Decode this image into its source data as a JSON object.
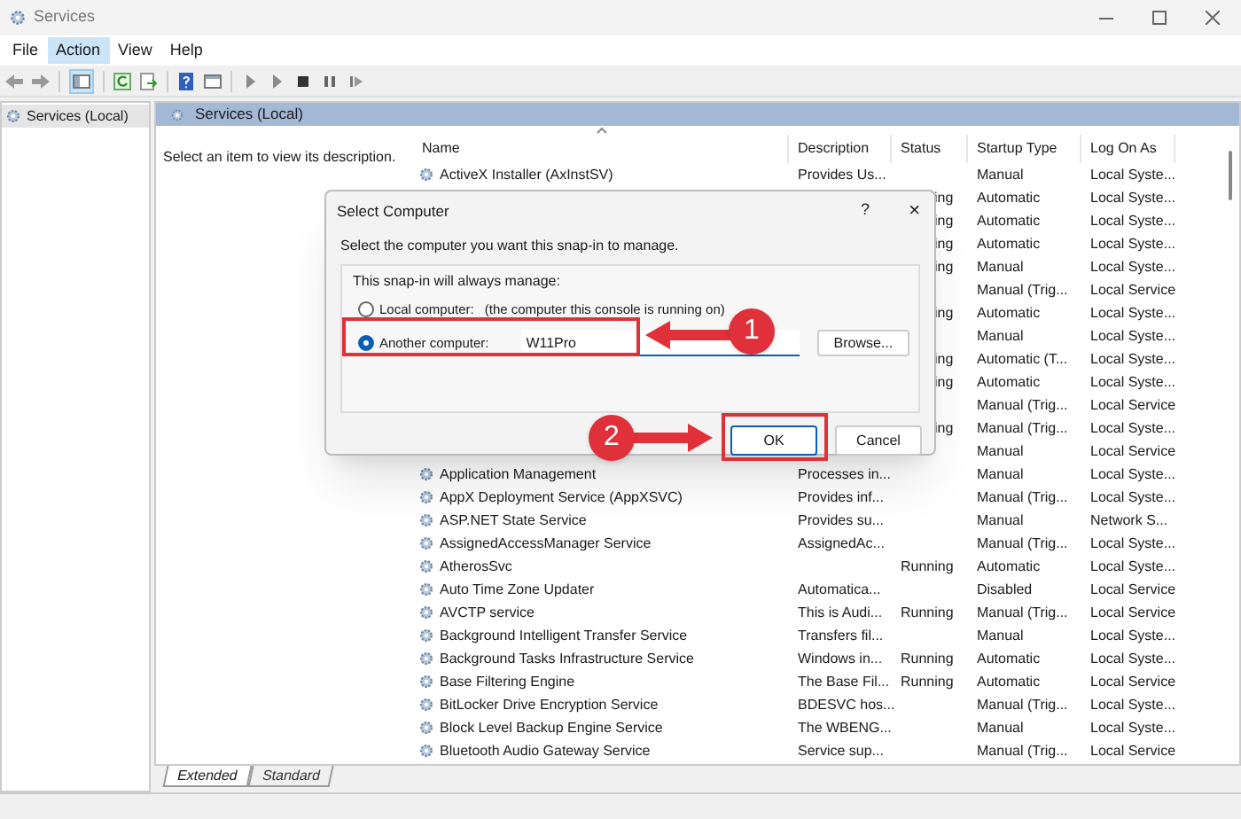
{
  "window": {
    "title": "Services"
  },
  "menu": [
    {
      "label": "File",
      "selected": false
    },
    {
      "label": "Action",
      "selected": true
    },
    {
      "label": "View",
      "selected": false
    },
    {
      "label": "Help",
      "selected": false
    }
  ],
  "toolbar": {
    "console_tree_pressed": true
  },
  "tree": {
    "items": [
      {
        "label": "Services (Local)",
        "selected": true
      }
    ]
  },
  "pane": {
    "title": "Services (Local)",
    "description_hint": "Select an item to view its description."
  },
  "table": {
    "columns": [
      "Name",
      "Description",
      "Status",
      "Startup Type",
      "Log On As"
    ],
    "rows": [
      {
        "kind": "full",
        "name": "ActiveX Installer (AxInstSV)",
        "description": "Provides Us...",
        "status": "",
        "startup": "Manual",
        "logon": "Local Syste..."
      },
      {
        "kind": "covered",
        "status": "ing",
        "startup": "Automatic",
        "logon": "Local Syste..."
      },
      {
        "kind": "covered",
        "status": "ing",
        "startup": "Automatic",
        "logon": "Local Syste..."
      },
      {
        "kind": "covered",
        "status": "ing",
        "startup": "Automatic",
        "logon": "Local Syste..."
      },
      {
        "kind": "covered",
        "status": "ing",
        "startup": "Manual",
        "logon": "Local Syste..."
      },
      {
        "kind": "covered",
        "status": "",
        "startup": "Manual (Trig...",
        "logon": "Local Service"
      },
      {
        "kind": "covered",
        "status": "ing",
        "startup": "Automatic",
        "logon": "Local Syste..."
      },
      {
        "kind": "covered",
        "status": "",
        "startup": "Manual",
        "logon": "Local Syste..."
      },
      {
        "kind": "covered",
        "status": "ing",
        "startup": "Automatic (T...",
        "logon": "Local Syste..."
      },
      {
        "kind": "covered",
        "status": "ing",
        "startup": "Automatic",
        "logon": "Local Syste..."
      },
      {
        "kind": "covered",
        "status": "",
        "startup": "Manual (Trig...",
        "logon": "Local Service"
      },
      {
        "kind": "covered",
        "status": "ing",
        "startup": "Manual (Trig...",
        "logon": "Local Syste..."
      },
      {
        "kind": "covered",
        "status": "",
        "startup": "Manual",
        "logon": "Local Service"
      },
      {
        "kind": "full",
        "name": "Application Management",
        "description": "Processes in...",
        "status": "",
        "startup": "Manual",
        "logon": "Local Syste..."
      },
      {
        "kind": "full",
        "name": "AppX Deployment Service (AppXSVC)",
        "description": "Provides inf...",
        "status": "",
        "startup": "Manual (Trig...",
        "logon": "Local Syste..."
      },
      {
        "kind": "full",
        "name": "ASP.NET State Service",
        "description": "Provides su...",
        "status": "",
        "startup": "Manual",
        "logon": "Network S..."
      },
      {
        "kind": "full",
        "name": "AssignedAccessManager Service",
        "description": "AssignedAc...",
        "status": "",
        "startup": "Manual (Trig...",
        "logon": "Local Syste..."
      },
      {
        "kind": "full",
        "name": "AtherosSvc",
        "description": "",
        "status": "Running",
        "startup": "Automatic",
        "logon": "Local Syste..."
      },
      {
        "kind": "full",
        "name": "Auto Time Zone Updater",
        "description": "Automatica...",
        "status": "",
        "startup": "Disabled",
        "logon": "Local Service"
      },
      {
        "kind": "full",
        "name": "AVCTP service",
        "description": "This is Audi...",
        "status": "Running",
        "startup": "Manual (Trig...",
        "logon": "Local Service"
      },
      {
        "kind": "full",
        "name": "Background Intelligent Transfer Service",
        "description": "Transfers fil...",
        "status": "",
        "startup": "Manual",
        "logon": "Local Syste..."
      },
      {
        "kind": "full",
        "name": "Background Tasks Infrastructure Service",
        "description": "Windows in...",
        "status": "Running",
        "startup": "Automatic",
        "logon": "Local Syste..."
      },
      {
        "kind": "full",
        "name": "Base Filtering Engine",
        "description": "The Base Fil...",
        "status": "Running",
        "startup": "Automatic",
        "logon": "Local Service"
      },
      {
        "kind": "full",
        "name": "BitLocker Drive Encryption Service",
        "description": "BDESVC hos...",
        "status": "",
        "startup": "Manual (Trig...",
        "logon": "Local Syste..."
      },
      {
        "kind": "full",
        "name": "Block Level Backup Engine Service",
        "description": "The WBENG...",
        "status": "",
        "startup": "Manual",
        "logon": "Local Syste..."
      },
      {
        "kind": "full",
        "name": "Bluetooth Audio Gateway Service",
        "description": "Service sup...",
        "status": "",
        "startup": "Manual (Trig...",
        "logon": "Local Service"
      }
    ]
  },
  "view_tabs": [
    {
      "label": "Extended",
      "selected": true
    },
    {
      "label": "Standard",
      "selected": false
    }
  ],
  "dialog": {
    "title": "Select Computer",
    "help": "?",
    "close": "×",
    "instruction": "Select the computer you want this snap-in to manage.",
    "group_label": "This snap-in will always manage:",
    "options": [
      {
        "label": "Local computer:",
        "note": "(the computer this console is running on)",
        "selected": false
      },
      {
        "label": "Another computer:",
        "value": "W11Pro",
        "selected": true
      }
    ],
    "browse": "Browse...",
    "ok": "OK",
    "cancel": "Cancel"
  },
  "annotations": [
    {
      "number": "1"
    },
    {
      "number": "2"
    }
  ]
}
